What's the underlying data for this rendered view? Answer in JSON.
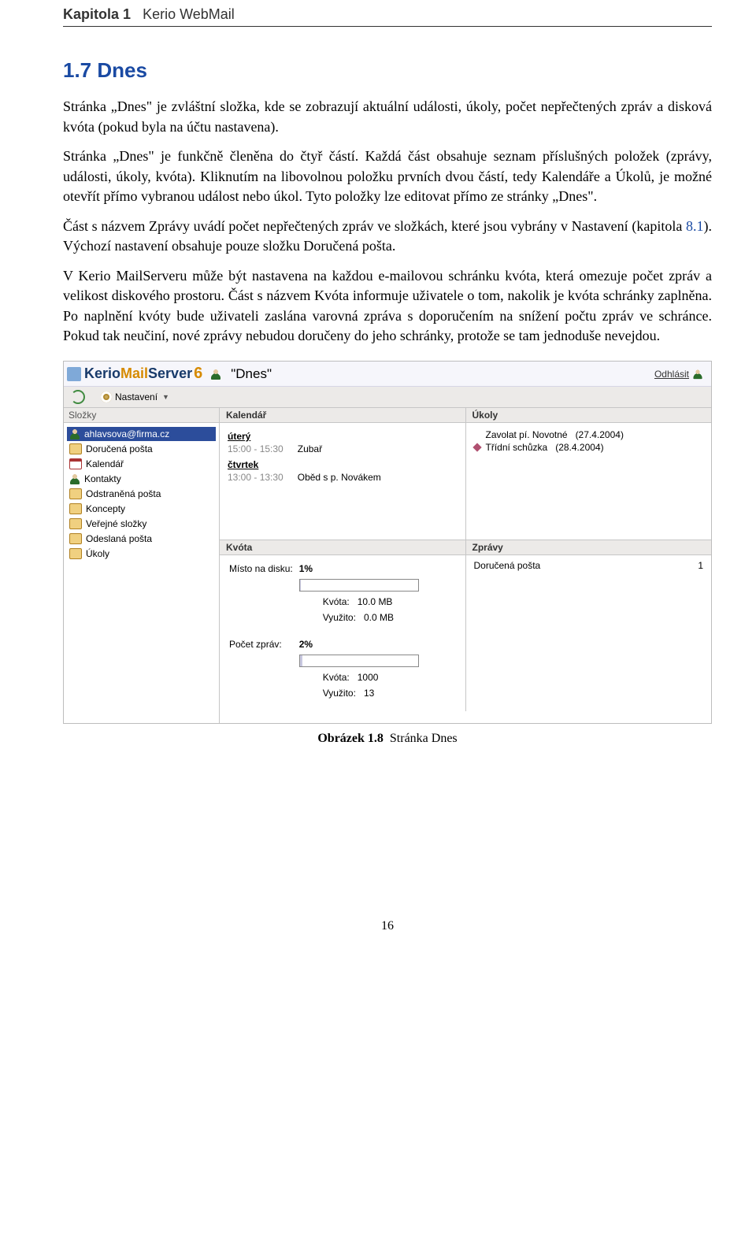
{
  "running_head": {
    "chapter": "Kapitola 1",
    "title": "Kerio WebMail"
  },
  "section_heading": "1.7 Dnes",
  "para1": "Stránka „Dnes\" je zvláštní složka, kde se zobrazují aktuální události, úkoly, počet nepřečtených zpráv a disková kvóta (pokud byla na účtu nastavena).",
  "para2": "Stránka „Dnes\" je funkčně členěna do čtyř částí. Každá část obsahuje seznam příslušných položek (zprávy, události, úkoly, kvóta). Kliknutím na libovolnou položku prvních dvou částí, tedy Kalendáře a Úkolů, je možné otevřít přímo vybranou událost nebo úkol. Tyto položky lze editovat přímo ze stránky „Dnes\".",
  "para3_a": "Část s názvem Zprávy uvádí počet nepřečtených zpráv ve složkách, které jsou vybrány v Nastavení (kapitola ",
  "para3_link": "8.1",
  "para3_b": "). Výchozí nastavení obsahuje pouze složku Doručená pošta.",
  "para4": "V Kerio MailServeru může být nastavena na každou e-mailovou schránku kvóta, která omezuje počet zpráv a velikost diskového prostoru. Část s názvem Kvóta informuje uživatele o tom, nakolik je kvóta schránky zaplněna. Po naplnění kvóty bude uživateli zaslána varovná zpráva s doporučením na snížení počtu zpráv ve schránce. Pokud tak neučiní, nové zprávy nebudou doručeny do jeho schránky, protože se tam jednoduše nevejdou.",
  "figure": {
    "brand": {
      "p1": "Kerio",
      "p2": "Mail",
      "p3": "Server",
      "p4": "6"
    },
    "current_page_label": "\"Dnes\"",
    "logout": "Odhlásit",
    "toolbar_settings": "Nastavení",
    "sidebar_header": "Složky",
    "folders": [
      {
        "label": "ahlavsova@firma.cz",
        "sel": true,
        "icon": "person"
      },
      {
        "label": "Doručená pošta",
        "icon": "folder"
      },
      {
        "label": "Kalendář",
        "icon": "cal"
      },
      {
        "label": "Kontakty",
        "icon": "person"
      },
      {
        "label": "Odstraněná pošta",
        "icon": "folder"
      },
      {
        "label": "Koncepty",
        "icon": "folder"
      },
      {
        "label": "Veřejné složky",
        "icon": "folder"
      },
      {
        "label": "Odeslaná pošta",
        "icon": "folder"
      },
      {
        "label": "Úkoly",
        "icon": "folder"
      }
    ],
    "calendar": {
      "title": "Kalendář",
      "days": [
        {
          "name": "úterý",
          "rows": [
            {
              "time": "15:00 - 15:30",
              "event": "Zubař"
            }
          ]
        },
        {
          "name": "čtvrtek",
          "rows": [
            {
              "time": "13:00 - 13:30",
              "event": "Oběd s p. Novákem"
            }
          ]
        }
      ]
    },
    "tasks": {
      "title": "Úkoly",
      "items": [
        {
          "label": "Zavolat pí. Novotné",
          "date": "(27.4.2004)",
          "flag": false
        },
        {
          "label": "Třídní schůzka",
          "date": "(28.4.2004)",
          "flag": true
        }
      ]
    },
    "quota": {
      "title": "Kvóta",
      "disk_label": "Místo na disku:",
      "disk_pct": "1%",
      "disk_quota_label": "Kvóta:",
      "disk_quota_val": "10.0 MB",
      "disk_used_label": "Využito:",
      "disk_used_val": "0.0 MB",
      "msgs_label": "Počet zpráv:",
      "msgs_pct": "2%",
      "msgs_quota_label": "Kvóta:",
      "msgs_quota_val": "1000",
      "msgs_used_label": "Využito:",
      "msgs_used_val": "13"
    },
    "messages": {
      "title": "Zprávy",
      "rows": [
        {
          "folder": "Doručená pošta",
          "count": "1"
        }
      ]
    }
  },
  "caption_bold": "Obrázek 1.8",
  "caption_rest": "Stránka Dnes",
  "page_number": "16"
}
